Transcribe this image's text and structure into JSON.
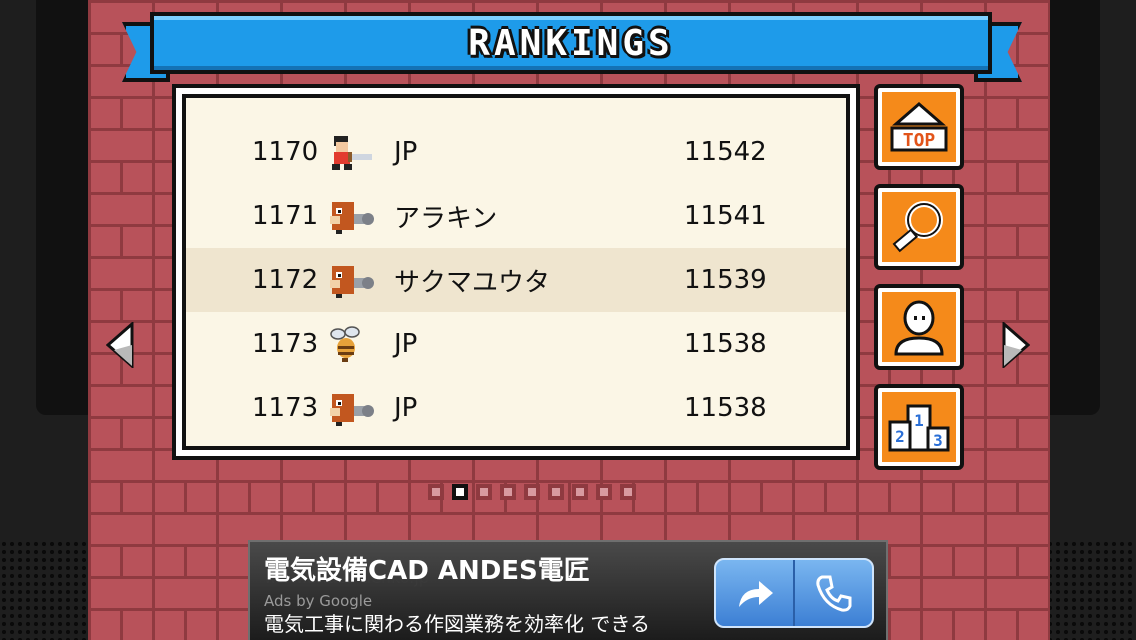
{
  "title": "RANKINGS",
  "rankings": [
    {
      "rank": "1170",
      "avatar": "hero-with-sword-sprite",
      "name": "JP",
      "score": "11542"
    },
    {
      "rank": "1171",
      "avatar": "brown-dog-sprite",
      "name": "アラキン",
      "score": "11541"
    },
    {
      "rank": "1172",
      "avatar": "brown-dog-sprite",
      "name": "サクマユウタ",
      "score": "11539"
    },
    {
      "rank": "1173",
      "avatar": "bee-sprite",
      "name": "JP",
      "score": "11538"
    },
    {
      "rank": "1173",
      "avatar": "brown-dog-sprite",
      "name": "JP",
      "score": "11538"
    }
  ],
  "highlighted_row": 3,
  "side_buttons": [
    {
      "icon": "top-arrow-icon",
      "label": "TOP"
    },
    {
      "icon": "magnifier-icon"
    },
    {
      "icon": "profile-icon"
    },
    {
      "icon": "podium-icon",
      "podium": [
        "1",
        "2",
        "3"
      ]
    }
  ],
  "pagination": {
    "pages": 9,
    "current": 2
  },
  "ad": {
    "title": "電気設備CAD ANDES電匠",
    "url": "www.andes-denko.jp",
    "attribution": "Ads by Google",
    "description": "電気工事に関わる作図業務を効率化 できる"
  },
  "colors": {
    "banner": "#1e9bea",
    "brick": "#b8525a",
    "button": "#f58a1a",
    "panel": "#fbf6e6",
    "highlight": "#efe5cf"
  }
}
